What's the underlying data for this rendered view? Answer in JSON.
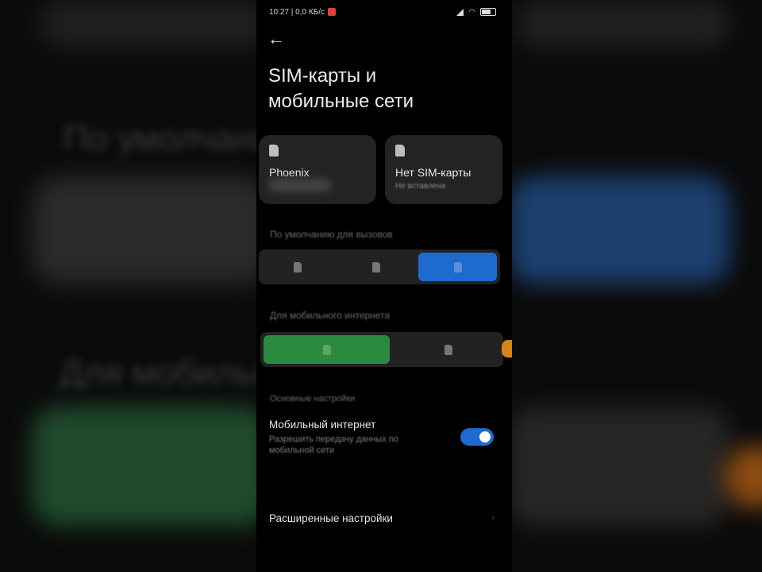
{
  "status_bar": {
    "time": "10:27 | 0,0 КБ/с",
    "icons": [
      "record-icon",
      "signal-icon",
      "wifi-icon",
      "battery-icon"
    ]
  },
  "background": {
    "text_1": "По умолчанию",
    "text_2": "Для мобильн"
  },
  "header": {
    "back_icon": "←",
    "title": "SIM-карты и мобильные сети"
  },
  "sim_cards": [
    {
      "name": "Phoenix",
      "sub": ""
    },
    {
      "name": "Нет SIM-карты",
      "sub": "Не вставлена"
    }
  ],
  "calls_section": {
    "label": "По умолчанию для вызовов",
    "options": [
      "sim1",
      "sim2",
      "ask"
    ],
    "selected_index": 2
  },
  "data_section": {
    "label": "Для мобильного интернета",
    "options": [
      "sim1",
      "sim2"
    ],
    "selected_index": 0
  },
  "basic_settings": {
    "label": "Основные настройки",
    "mobile_internet_title": "Мобильный интернет",
    "mobile_internet_sub": "Разрешить передачу данных по мобильной сети",
    "mobile_internet_on": true
  },
  "advanced": {
    "label": "Расширенные настройки"
  },
  "colors": {
    "accent_blue": "#1f6ad0",
    "accent_green": "#2b8a3e",
    "background": "#000000",
    "card": "#232323"
  }
}
